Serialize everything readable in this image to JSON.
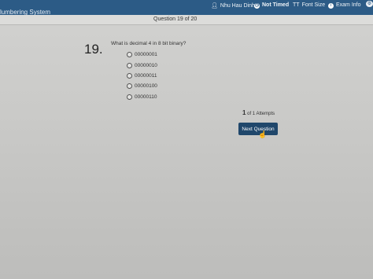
{
  "header": {
    "app_title": "lumbering System",
    "user_name": "Nhu Hau Dinh",
    "timer": "Not Timed",
    "font_size": "Font Size",
    "font_size_icon": "TT",
    "exam_info": "Exam Info",
    "icons": [
      "user-icon",
      "clock-icon",
      "font-size-icon",
      "info-icon"
    ]
  },
  "question": {
    "counter": "Question 19 of 20",
    "number": "19.",
    "text": "What is decimal 4 in 8 bit binary?",
    "options": [
      "00000001",
      "00000010",
      "00000011",
      "00000100",
      "00000110"
    ],
    "selected_index": null
  },
  "attempts": {
    "count": "1",
    "text": "of 1 Attempts"
  },
  "buttons": {
    "next_label": "Next Question"
  },
  "colors": {
    "header_bg": "#2c5b86",
    "button_bg": "#20476b"
  }
}
